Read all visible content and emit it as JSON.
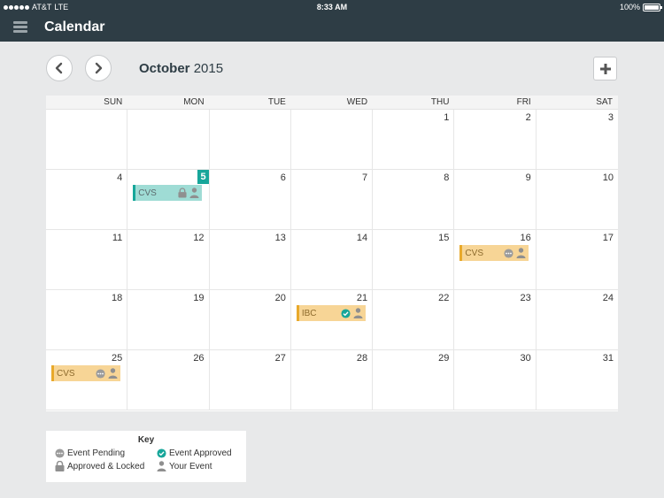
{
  "status_bar": {
    "carrier": "AT&T",
    "network": "LTE",
    "time": "8:33 AM",
    "battery": "100%"
  },
  "nav": {
    "title": "Calendar"
  },
  "header": {
    "month": "October",
    "year": "2015"
  },
  "days_of_week": [
    "SUN",
    "MON",
    "TUE",
    "WED",
    "THU",
    "FRI",
    "SAT"
  ],
  "weeks": [
    [
      "",
      "",
      "",
      "",
      "1",
      "2",
      "3"
    ],
    [
      "4",
      "5",
      "6",
      "7",
      "8",
      "9",
      "10"
    ],
    [
      "11",
      "12",
      "13",
      "14",
      "15",
      "16",
      "17"
    ],
    [
      "18",
      "19",
      "20",
      "21",
      "22",
      "23",
      "24"
    ],
    [
      "25",
      "26",
      "27",
      "28",
      "29",
      "30",
      "31"
    ]
  ],
  "today": "5",
  "events": [
    {
      "day": "5",
      "label": "CVS",
      "status": "locked",
      "color": "teal"
    },
    {
      "day": "16",
      "label": "CVS",
      "status": "pending",
      "color": "orange"
    },
    {
      "day": "21",
      "label": "IBC",
      "status": "approved",
      "color": "orange"
    },
    {
      "day": "25",
      "label": "CVS",
      "status": "pending",
      "color": "orange"
    }
  ],
  "key": {
    "title": "Key",
    "pending": "Event Pending",
    "approved": "Event Approved",
    "locked": "Approved & Locked",
    "yours": "Your Event"
  },
  "colors": {
    "accent": "#17a69a",
    "pending": "#f7d596",
    "nav": "#2e3d45"
  }
}
